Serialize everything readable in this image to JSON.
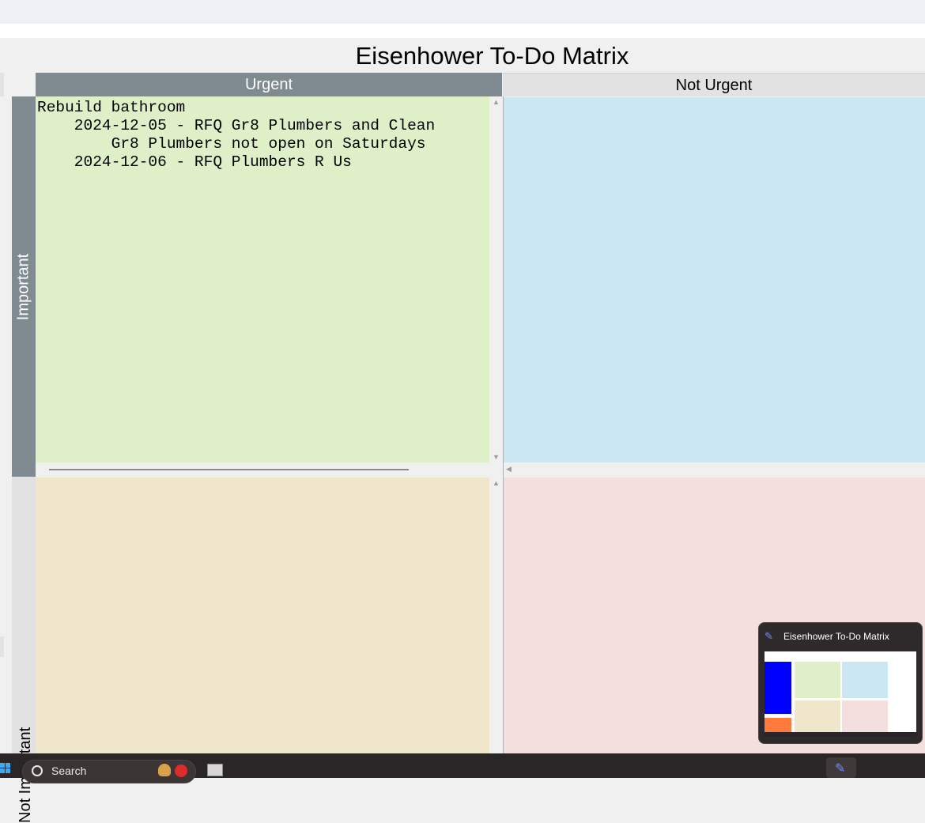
{
  "window": {
    "title": "Eisenhower To-Do Matrix"
  },
  "matrix": {
    "columns": {
      "urgent": "Urgent",
      "not_urgent": "Not Urgent"
    },
    "rows": {
      "important": "Important",
      "not_important": "Not Important"
    },
    "quadrants": {
      "urgent_important": "Rebuild bathroom\n    2024-12-05 - RFQ Gr8 Plumbers and Clean\n        Gr8 Plumbers not open on Saturdays\n    2024-12-06 - RFQ Plumbers R Us",
      "not_urgent_important": "",
      "urgent_not_important": "",
      "not_urgent_not_important": ""
    },
    "colors": {
      "urgent_important": "#dff0c8",
      "not_urgent_important": "#cbe8f2",
      "urgent_not_important": "#f0e6cb",
      "not_urgent_not_important": "#f3dfde",
      "header_active": "#7f8b90",
      "header_inactive": "#e2e2e2"
    }
  },
  "taskbar": {
    "search_placeholder": "Search",
    "preview_title": "Eisenhower To-Do Matrix"
  }
}
